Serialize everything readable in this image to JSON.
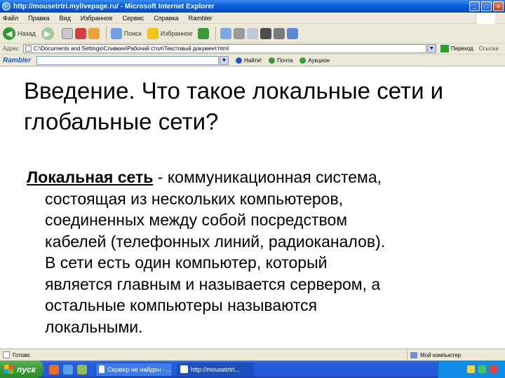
{
  "window": {
    "title": "http://mousetrtri.mylivepage.ru/ - Microsoft Internet Explorer"
  },
  "menu": [
    "Файл",
    "Правка",
    "Вид",
    "Избранное",
    "Сервис",
    "Справка",
    "Rambler"
  ],
  "toolbar": {
    "back_label": "Назад",
    "search_label": "Поиск",
    "favorites_label": "Избранное"
  },
  "address": {
    "label": "Адрес",
    "value": "C:\\Documents and Settings\\Сливкин\\Рабочий стол\\Текстовый документ.html",
    "go_label": "Переход",
    "links_label": "Ссылки"
  },
  "rambler": {
    "logo": "Rambler",
    "find_label": "Найти!",
    "mail_label": "Почта",
    "auction_label": "Аукцион"
  },
  "content": {
    "heading": "Введение. Что такое локальные сети и глобальные сети?",
    "term": "Локальная сеть",
    "first_line_rest": " - коммуникационная система,",
    "lines": [
      "состоящая из нескольких компьютеров,",
      "соединенных между собой посредством",
      "кабелей (телефонных линий, радиоканалов).",
      "В сети есть один компьютер, который",
      "является главным и называется сервером, а",
      "остальные компьютеры называются",
      "локальными."
    ]
  },
  "status": {
    "text": "Готово",
    "zone": "Мой компьютер"
  },
  "taskbar": {
    "start_label": "пуск",
    "tasks": [
      "Сервер не найден - ...",
      "http://mousetrtri..."
    ]
  },
  "colors": {
    "titlebar": "#0a5fd8",
    "taskbar": "#245edb",
    "start": "#3a9a3a",
    "chrome": "#ece9d8"
  }
}
